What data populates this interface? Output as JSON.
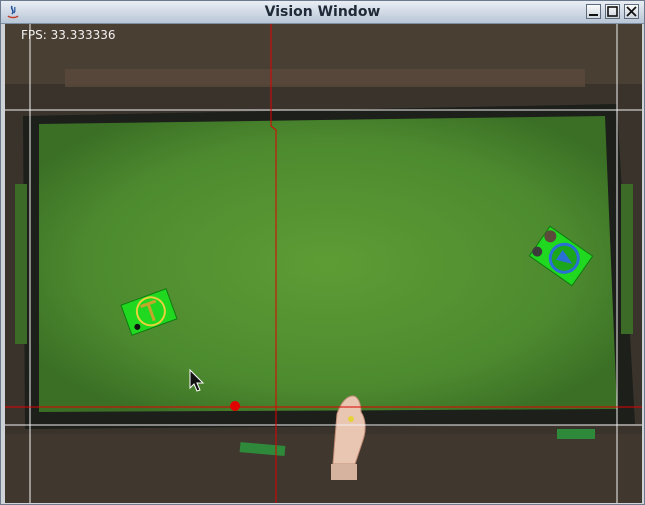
{
  "window": {
    "title": "Vision Window",
    "minimize_icon": "minimize-icon",
    "maximize_icon": "maximize-icon",
    "close_icon": "close-icon"
  },
  "overlay": {
    "fps_text": "FPS: 33.333336"
  },
  "colors": {
    "field_green": "#4f8a2f",
    "overlay_red": "#e00000",
    "overlay_white": "#f2f2f2",
    "robot_green": "#1fd81f"
  }
}
